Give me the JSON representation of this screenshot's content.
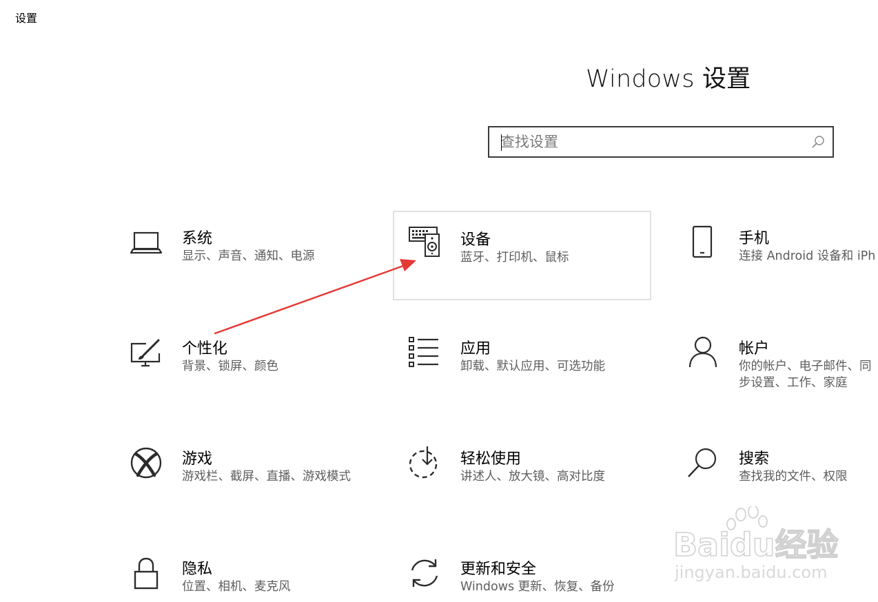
{
  "window": {
    "title": "设置"
  },
  "header": {
    "title": "Windows 设置"
  },
  "search": {
    "placeholder": "查找设置"
  },
  "tiles": [
    {
      "title": "系统",
      "desc": "显示、声音、通知、电源",
      "icon": "laptop-icon"
    },
    {
      "title": "设备",
      "desc": "蓝牙、打印机、鼠标",
      "icon": "devices-icon"
    },
    {
      "title": "手机",
      "desc": "连接 Android 设备和 iPh",
      "icon": "phone-icon"
    },
    {
      "title": "个性化",
      "desc": "背景、锁屏、颜色",
      "icon": "personalization-icon"
    },
    {
      "title": "应用",
      "desc": "卸载、默认应用、可选功能",
      "icon": "apps-list-icon"
    },
    {
      "title": "帐户",
      "desc": "你的帐户、电子邮件、同步设置、工作、家庭",
      "icon": "account-icon"
    },
    {
      "title": "游戏",
      "desc": "游戏栏、截屏、直播、游戏模式",
      "icon": "xbox-icon"
    },
    {
      "title": "轻松使用",
      "desc": "讲述人、放大镜、高对比度",
      "icon": "ease-of-access-icon"
    },
    {
      "title": "搜索",
      "desc": "查找我的文件、权限",
      "icon": "search-icon"
    },
    {
      "title": "隐私",
      "desc": "位置、相机、麦克风",
      "icon": "lock-icon"
    },
    {
      "title": "更新和安全",
      "desc": "Windows 更新、恢复、备份",
      "icon": "update-icon"
    }
  ],
  "watermark": {
    "brand": "Baidu经验",
    "url": "jingyan.baidu.com"
  },
  "colors": {
    "annotation_arrow": "#e53935",
    "icon_stroke": "#2b2b2b"
  }
}
